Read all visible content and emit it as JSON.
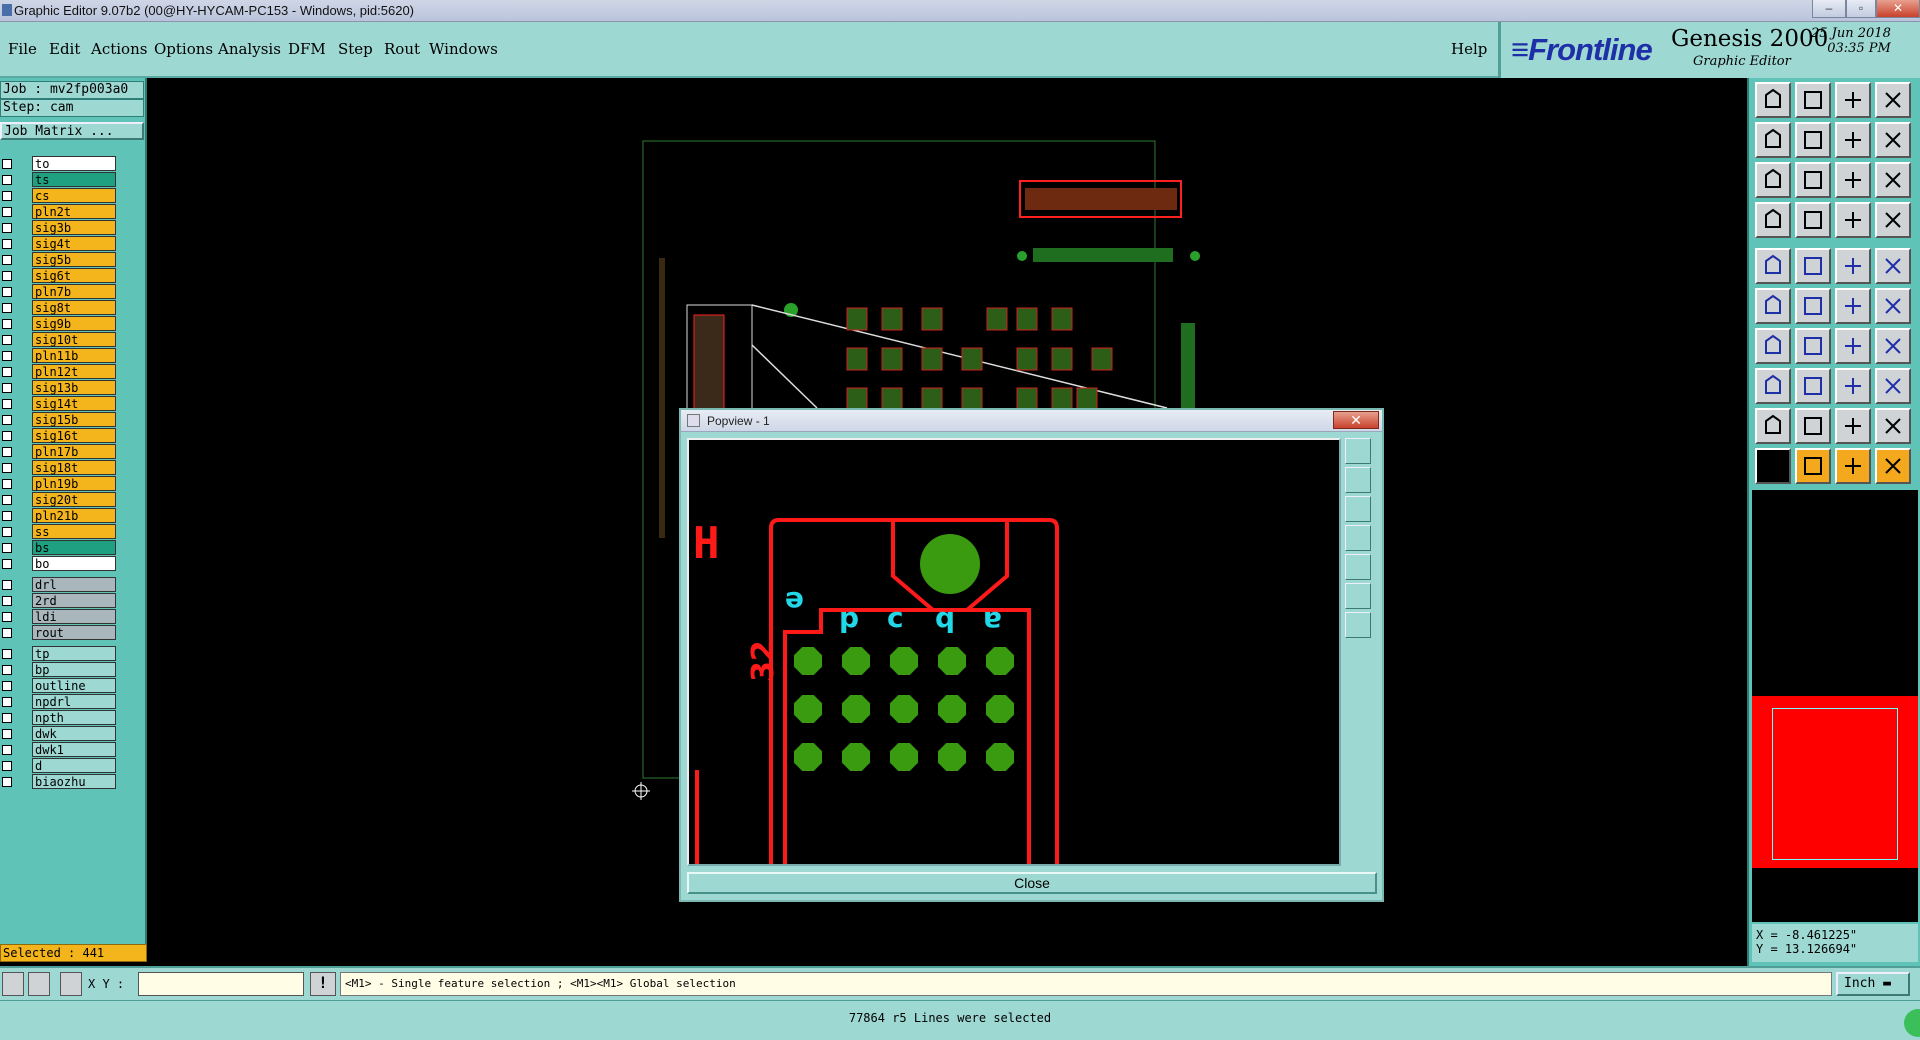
{
  "window": {
    "title": "Graphic Editor 9.07b2 (00@HY-HYCAM-PC153 - Windows, pid:5620)"
  },
  "menu": {
    "file": "File",
    "edit": "Edit",
    "actions": "Actions",
    "options": "Options",
    "analysis": "Analysis",
    "dfm": "DFM",
    "step": "Step",
    "rout": "Rout",
    "windows": "Windows",
    "help": "Help"
  },
  "brand": {
    "logo": "Frontline",
    "product": "Genesis 2000",
    "subtitle": "Graphic Editor",
    "date": "25 Jun 2018",
    "time": "03:35 PM"
  },
  "job": {
    "job": "Job : mv2fp003a0",
    "step": "Step: cam",
    "matrix": "Job Matrix ..."
  },
  "layers_board": [
    "to",
    "ts",
    "cs",
    "pln2t",
    "sig3b",
    "sig4t",
    "sig5b",
    "sig6t",
    "pln7b",
    "sig8t",
    "sig9b",
    "sig10t",
    "pln11b",
    "pln12t",
    "sig13b",
    "sig14t",
    "sig15b",
    "sig16t",
    "pln17b",
    "sig18t",
    "pln19b",
    "sig20t",
    "pln21b",
    "ss",
    "bs",
    "bo"
  ],
  "layers_drill": [
    "drl",
    "2rd",
    "ldi",
    "rout"
  ],
  "layers_misc": [
    "tp",
    "bp",
    "outline",
    "npdrl",
    "npth",
    "dwk",
    "dwk1",
    "d",
    "biaozhu"
  ],
  "selected_count": "Selected : 441",
  "popview": {
    "title": "Popview - 1",
    "close_label": "Close",
    "close_x": "✕",
    "pin_label": "32",
    "designator": "H",
    "column_labels": [
      "ə",
      "p",
      "c",
      "q",
      "ɐ"
    ]
  },
  "coords": {
    "x": "X = -8.461225\"",
    "y": "Y = 13.126694\""
  },
  "command": {
    "xy_label": "X Y :",
    "xy_value": "",
    "hint": "<M1> - Single feature selection ; <M1><M1> Global selection",
    "units": "Inch"
  },
  "status": {
    "message": "77864 r5 Lines were selected"
  },
  "colors": {
    "panel_teal": "#5fc3b8",
    "menubar_teal": "#9ed8d3",
    "signal_layer": "#f4b51c",
    "selected_layer": "#1fa080",
    "drill_layer": "#a9b7bd",
    "copper_red": "#ff0000",
    "pad_green": "#3a9a10",
    "text_cyan": "#22d8e8"
  }
}
